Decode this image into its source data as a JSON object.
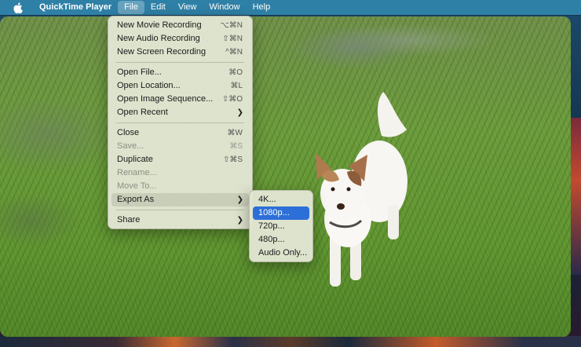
{
  "menubar": {
    "apple_icon": "apple-logo-icon",
    "app_name": "QuickTime Player",
    "items": [
      "File",
      "Edit",
      "View",
      "Window",
      "Help"
    ],
    "active_item": "File",
    "color": "#2f80a6"
  },
  "file_menu": {
    "groups": [
      [
        {
          "label": "New Movie Recording",
          "shortcut": "⌥⌘N",
          "enabled": true
        },
        {
          "label": "New Audio Recording",
          "shortcut": "⇧⌘N",
          "enabled": true
        },
        {
          "label": "New Screen Recording",
          "shortcut": "^⌘N",
          "enabled": true
        }
      ],
      [
        {
          "label": "Open File...",
          "shortcut": "⌘O",
          "enabled": true
        },
        {
          "label": "Open Location...",
          "shortcut": "⌘L",
          "enabled": true
        },
        {
          "label": "Open Image Sequence...",
          "shortcut": "⇧⌘O",
          "enabled": true
        },
        {
          "label": "Open Recent",
          "submenu": true,
          "enabled": true
        }
      ],
      [
        {
          "label": "Close",
          "shortcut": "⌘W",
          "enabled": true
        },
        {
          "label": "Save...",
          "shortcut": "⌘S",
          "enabled": false
        },
        {
          "label": "Duplicate",
          "shortcut": "⇧⌘S",
          "enabled": true
        },
        {
          "label": "Rename...",
          "enabled": false
        },
        {
          "label": "Move To...",
          "enabled": false
        },
        {
          "label": "Export As",
          "submenu": true,
          "enabled": true,
          "highlighted": true
        }
      ],
      [
        {
          "label": "Share",
          "submenu": true,
          "enabled": true
        }
      ]
    ]
  },
  "export_submenu": {
    "items": [
      {
        "label": "4K..."
      },
      {
        "label": "1080p...",
        "selected": true
      },
      {
        "label": "720p..."
      },
      {
        "label": "480p..."
      },
      {
        "label": "Audio Only..."
      }
    ],
    "highlight_color": "#2d6fd8"
  }
}
